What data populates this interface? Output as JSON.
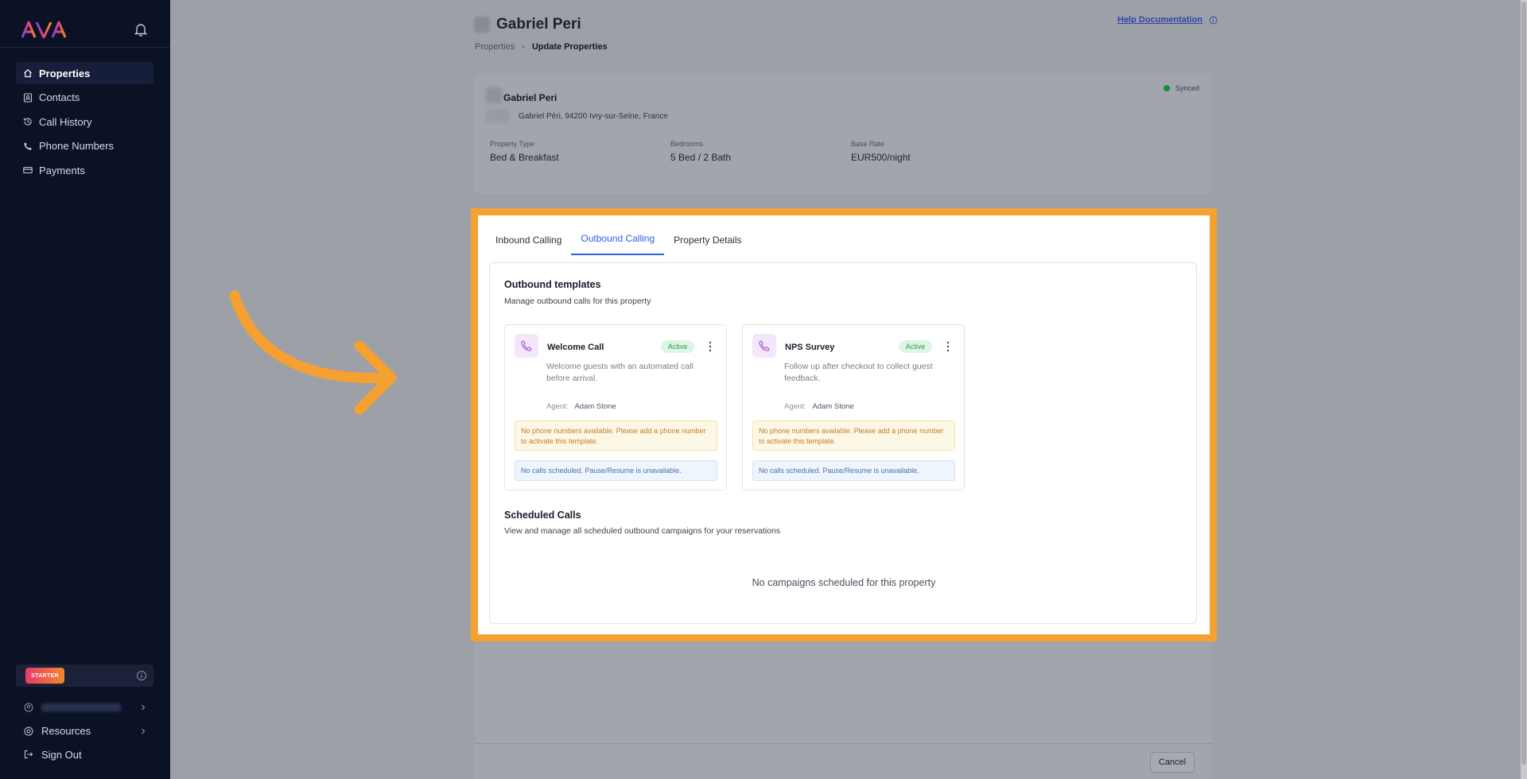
{
  "sidebar": {
    "logo_text": "AVA",
    "nav": [
      {
        "label": "Properties",
        "icon": "home-icon",
        "active": true
      },
      {
        "label": "Contacts",
        "icon": "contacts-icon",
        "active": false
      },
      {
        "label": "Call History",
        "icon": "history-icon",
        "active": false
      },
      {
        "label": "Phone Numbers",
        "icon": "phone-icon",
        "active": false
      },
      {
        "label": "Payments",
        "icon": "card-icon",
        "active": false
      }
    ],
    "plan_badge": "STARTER",
    "bottom": {
      "resources_label": "Resources",
      "signout_label": "Sign Out"
    }
  },
  "header": {
    "title": "Gabriel Peri",
    "breadcrumb": [
      "Properties",
      "Update Properties"
    ],
    "help_label": "Help Documentation"
  },
  "property": {
    "name": "Gabriel Peri",
    "address": "Gabriel Péri, 94200 Ivry-sur-Seine, France",
    "sync_status": "Synced",
    "stats": [
      {
        "label": "Property Type",
        "value": "Bed & Breakfast"
      },
      {
        "label": "Bedrooms",
        "value": "5 Bed / 2 Bath"
      },
      {
        "label": "Base Rate",
        "value": "EUR500/night"
      }
    ]
  },
  "tabs": [
    "Inbound Calling",
    "Outbound Calling",
    "Property Details"
  ],
  "active_tab": "Outbound Calling",
  "outbound": {
    "title": "Outbound templates",
    "subtitle": "Manage outbound calls for this property",
    "templates": [
      {
        "name": "Welcome Call",
        "status": "Active",
        "description": "Welcome guests with an automated call before arrival.",
        "agent_label": "Agent:",
        "agent": "Adam Stone",
        "warning": "No phone numbers available. Please add a phone number to activate this template.",
        "info": "No calls scheduled. Pause/Resume is unavailable."
      },
      {
        "name": "NPS Survey",
        "status": "Active",
        "description": "Follow up after checkout to collect guest feedback.",
        "agent_label": "Agent:",
        "agent": "Adam Stone",
        "warning": "No phone numbers available. Please add a phone number to activate this template.",
        "info": "No calls scheduled. Pause/Resume is unavailable."
      }
    ]
  },
  "scheduled": {
    "title": "Scheduled Calls",
    "subtitle": "View and manage all scheduled outbound campaigns for your reservations",
    "empty": "No campaigns scheduled for this property"
  },
  "footer": {
    "cancel_label": "Cancel"
  },
  "colors": {
    "highlight": "#f5a030",
    "accent": "#2e5fe0",
    "sidebar_bg": "#0c1226"
  }
}
